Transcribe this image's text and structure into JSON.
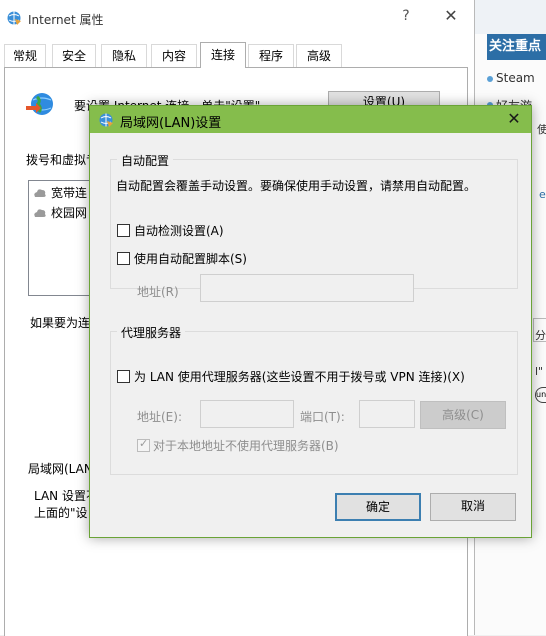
{
  "options_window": {
    "title": "Internet 属性",
    "help_label": "?",
    "close_label": "✕",
    "tabs": [
      "常规",
      "安全",
      "隐私",
      "内容",
      "连接",
      "程序",
      "高级"
    ],
    "active_tab": "连接",
    "setup_text": "要设置 Internet 连接，单击\"设置\"",
    "setup_button": "设置(U)",
    "dialup_label": "拨号和虚拟专",
    "dialup_items": [
      "宽带连",
      "校园网"
    ],
    "proxy_note": "如果要为连",
    "lan_section_label": "局域网(LAN",
    "lan_desc_1": "LAN 设置不",
    "lan_desc_2": "上面的\"设"
  },
  "browser_strip": {
    "header": "关注重点",
    "bullets": [
      "Steam",
      "好友游",
      "使"
    ],
    "link_fragment": "ea",
    "frag_1": "分",
    "frag_2": "l\"",
    "frag_circle": "un"
  },
  "lan_dialog": {
    "title": "局域网(LAN)设置",
    "close_label": "✕",
    "auto_group": {
      "legend": "自动配置",
      "note": "自动配置会覆盖手动设置。要确保使用手动设置，请禁用自动配置。",
      "auto_detect_label": "自动检测设置(A)",
      "auto_detect_checked": false,
      "auto_script_label": "使用自动配置脚本(S)",
      "auto_script_checked": false,
      "address_label": "地址(R)",
      "address_value": ""
    },
    "proxy_group": {
      "legend": "代理服务器",
      "use_proxy_label": "为 LAN 使用代理服务器(这些设置不用于拨号或 VPN 连接)(X)",
      "use_proxy_checked": false,
      "address_label": "地址(E):",
      "address_value": "",
      "port_label": "端口(T):",
      "port_value": "",
      "advanced_button": "高级(C)",
      "bypass_label": "对于本地地址不使用代理服务器(B)",
      "bypass_checked": true
    },
    "ok_button": "确定",
    "cancel_button": "取消"
  }
}
